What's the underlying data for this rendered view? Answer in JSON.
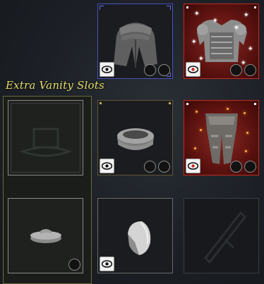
{
  "extra_vanity": {
    "title": "Extra Vanity Slots"
  },
  "slots": [
    {
      "id": "head-top",
      "item": "cloth-hood",
      "visible_toggle": true,
      "dye_slots": 2,
      "state": "selected"
    },
    {
      "id": "chest-top",
      "item": "plate-chest",
      "visible_toggle": true,
      "dye_slots": 2,
      "state": "legendary-sparkle"
    },
    {
      "id": "hat-extra",
      "item": "hat-silhouette",
      "visible_toggle": false,
      "dye_slots": 0,
      "state": "empty"
    },
    {
      "id": "wrist",
      "item": "bracer",
      "visible_toggle": true,
      "dye_slots": 2,
      "state": "rare"
    },
    {
      "id": "legs",
      "item": "plate-legs",
      "visible_toggle": true,
      "dye_slots": 2,
      "state": "legendary-ember"
    },
    {
      "id": "extra-cap",
      "item": "small-cap",
      "visible_toggle": false,
      "dye_slots": 1,
      "state": "normal"
    },
    {
      "id": "shoulder",
      "item": "pauldron",
      "visible_toggle": true,
      "dye_slots": 0,
      "state": "normal"
    },
    {
      "id": "weapon",
      "item": "sword-silhouette",
      "visible_toggle": false,
      "dye_slots": 0,
      "state": "empty"
    }
  ],
  "colors": {
    "title": "#e8df6a",
    "selected_border": "#4c4fbf",
    "legendary_border": "#c42a22",
    "rare_border": "#5f5437"
  }
}
